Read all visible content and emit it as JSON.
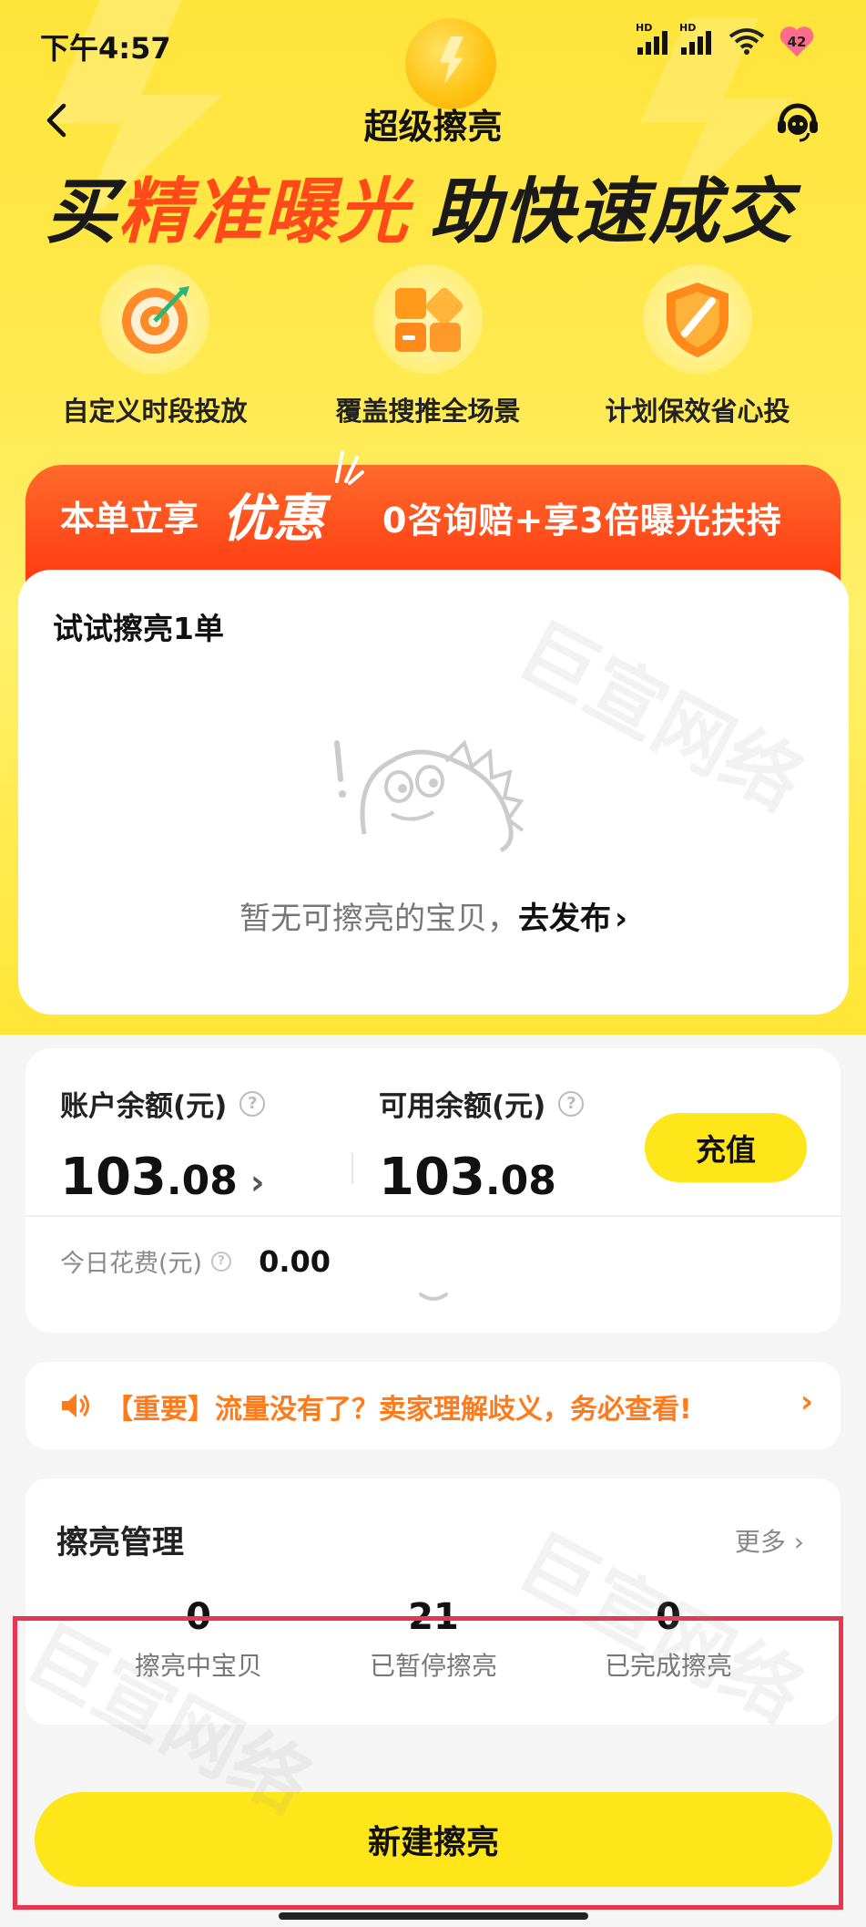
{
  "status_bar": {
    "time": "下午4:57",
    "signal_labels": [
      "HD",
      "HD"
    ],
    "battery": "42"
  },
  "nav": {
    "title": "超级擦亮"
  },
  "hero": {
    "slogan_part1": "买",
    "slogan_highlight": "精准曝光",
    "slogan_part2": "助快速成交",
    "features": [
      {
        "icon": "target-icon",
        "label": "自定义时段投放"
      },
      {
        "icon": "blocks-icon",
        "label": "覆盖搜推全场景"
      },
      {
        "icon": "shield-icon",
        "label": "计划保效省心投"
      }
    ]
  },
  "promo": {
    "left": "本单立享",
    "big": "优惠",
    "right": "0咨询赔+享3倍曝光扶持"
  },
  "try_card": {
    "title": "试试擦亮1单",
    "empty_text": "暂无可擦亮的宝贝，",
    "empty_link": "去发布",
    "chevron": "›"
  },
  "balance": {
    "account_label": "账户余额(元)",
    "account_int": "103",
    "account_dec": ".08",
    "account_arrow": "›",
    "available_label": "可用余额(元)",
    "available_int": "103",
    "available_dec": ".08",
    "topup_label": "充值",
    "today_label": "今日花费(元)",
    "today_value": "0.00",
    "help_glyph": "?"
  },
  "notice": {
    "text": "【重要】流量没有了？卖家理解歧义，务必查看!",
    "chevron": "›"
  },
  "management": {
    "title": "擦亮管理",
    "more_label": "更多 ›",
    "stats": [
      {
        "value": "0",
        "label": "擦亮中宝贝"
      },
      {
        "value": "21",
        "label": "已暂停擦亮"
      },
      {
        "value": "0",
        "label": "已完成擦亮"
      }
    ]
  },
  "cta": {
    "label": "新建擦亮"
  },
  "watermark": "巨宣网络",
  "colors": {
    "brand_yellow": "#ffe61a",
    "promo_red": "#ff3a12",
    "notice_orange": "#ff7a1a",
    "highlight_red": "#e8364f"
  }
}
